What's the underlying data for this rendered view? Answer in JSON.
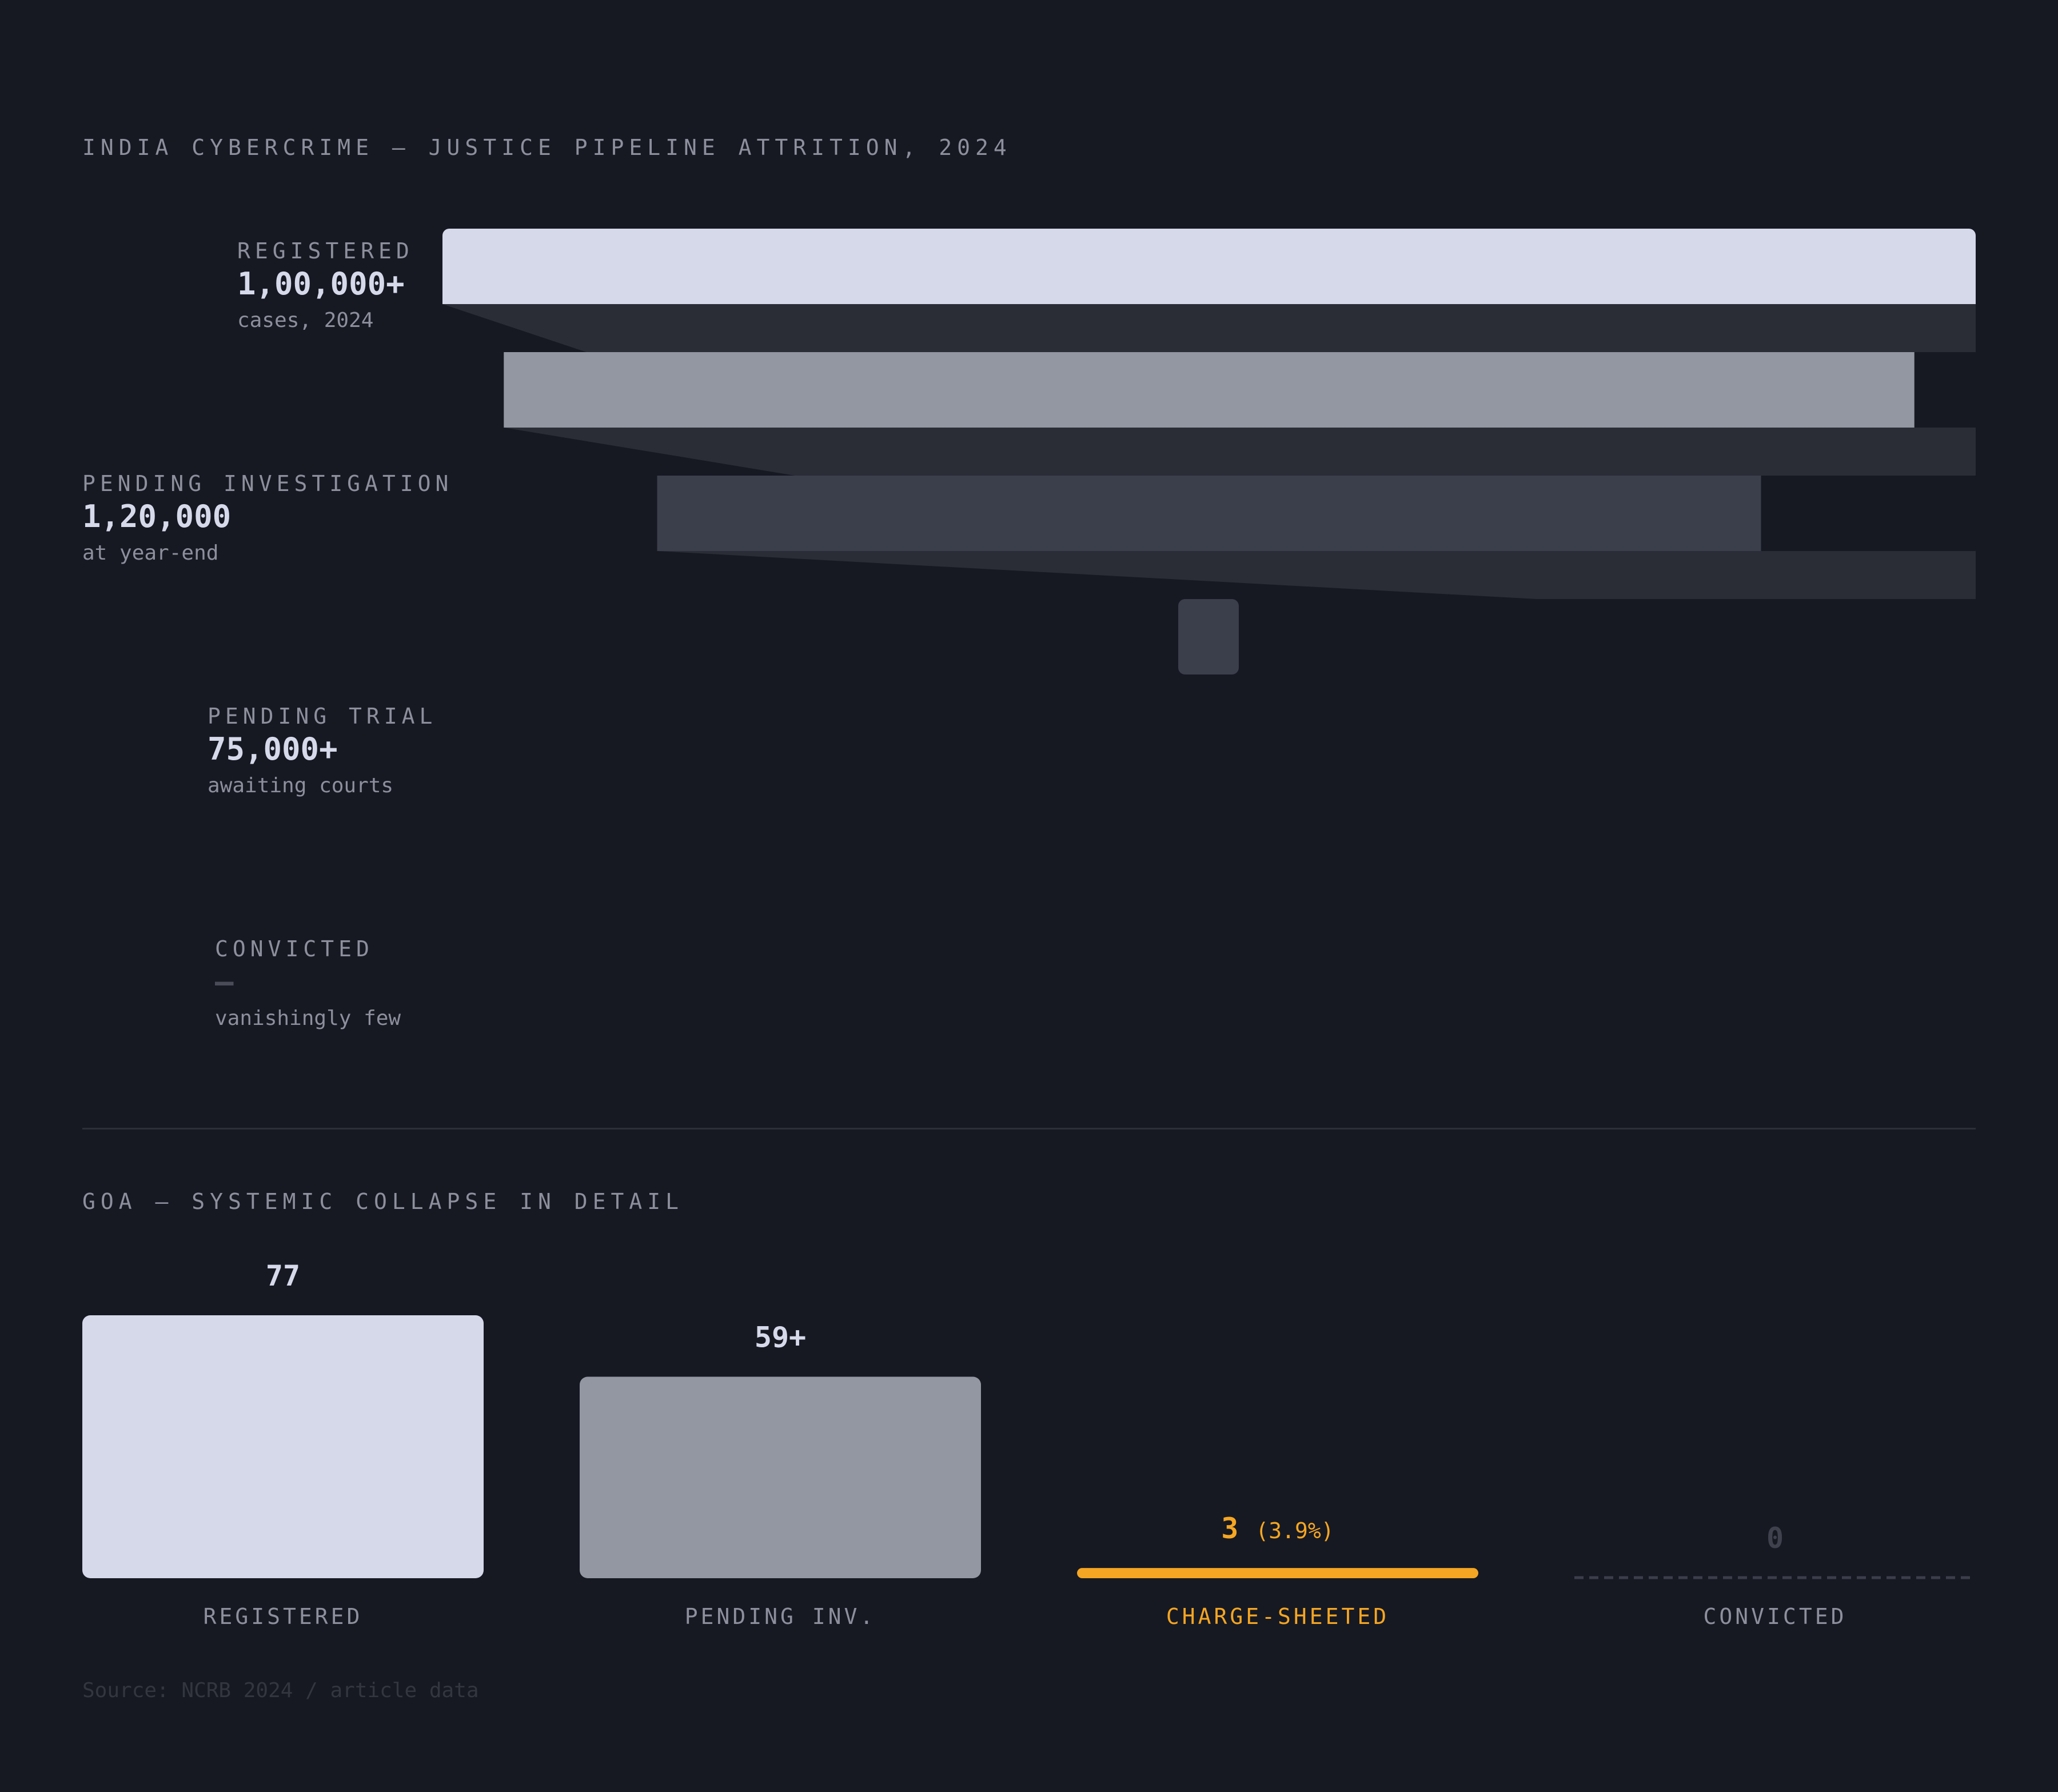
{
  "title": "INDIA CYBERCRIME — JUSTICE PIPELINE ATTRITION, 2024",
  "funnel_labels": [
    {
      "label": "REGISTERED",
      "value": "1,00,000+",
      "sub": "cases, 2024"
    },
    {
      "label": "PENDING INVESTIGATION",
      "value": "1,20,000",
      "sub": "at year-end"
    },
    {
      "label": "PENDING TRIAL",
      "value": "75,000+",
      "sub": "awaiting courts"
    },
    {
      "label": "CONVICTED",
      "value": "—",
      "sub": "vanishingly few"
    }
  ],
  "goa_title": "GOA — SYSTEMIC COLLAPSE IN DETAIL",
  "source": "Source: NCRB 2024 / article data",
  "colors": {
    "background": "#161922",
    "registered": "#d6d9ea",
    "pending_inv": "#9397a1",
    "pending_trial": "#3b3e4b",
    "connector": "#2a2d36",
    "charge_sheeted": "#f5a623",
    "muted": "#8d909c"
  },
  "chart_data": [
    {
      "type": "bar",
      "title": "INDIA CYBERCRIME — JUSTICE PIPELINE ATTRITION, 2024",
      "orientation": "horizontal-funnel",
      "categories": [
        "REGISTERED",
        "PENDING INVESTIGATION",
        "PENDING TRIAL",
        "CONVICTED"
      ],
      "values": [
        100000,
        92000,
        72000,
        4000
      ],
      "value_labels": [
        "1,00,000+",
        "1,20,000",
        "75,000+",
        "—"
      ]
    },
    {
      "type": "bar",
      "title": "GOA — SYSTEMIC COLLAPSE IN DETAIL",
      "categories": [
        "REGISTERED",
        "PENDING INV.",
        "CHARGE-SHEETED",
        "CONVICTED"
      ],
      "values": [
        77,
        59,
        3,
        0
      ],
      "value_labels": [
        "77",
        "59+",
        "3",
        "0"
      ],
      "annotations": [
        "",
        "",
        "(3.9%)",
        ""
      ],
      "ylim": [
        0,
        77
      ]
    }
  ]
}
